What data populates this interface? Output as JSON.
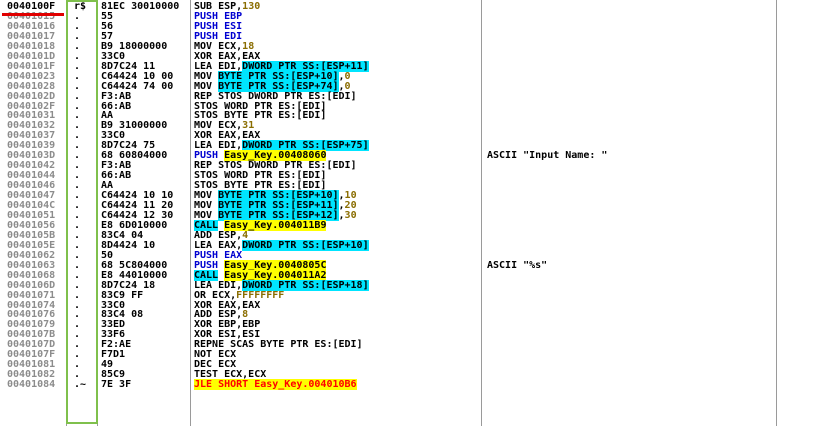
{
  "colors": {
    "cyan_highlight": "#00e5ff",
    "yellow_highlight": "#ffff00",
    "address": "#8c8c8c",
    "mnemonic_blue": "#0000d0",
    "annotation_green": "#7fc04c",
    "annotation_red": "#e00000"
  },
  "rows": [
    {
      "addr": "0040100F",
      "mark": "r$",
      "bytes": "81EC 30010000",
      "dis": [
        [
          "SUB ESP,",
          "black"
        ],
        [
          "130",
          "num"
        ]
      ],
      "cmt": ""
    },
    {
      "addr": "00401015",
      "mark": ".",
      "bytes": "55",
      "dis": [
        [
          "PUSH EBP",
          "blue"
        ]
      ],
      "cmt": ""
    },
    {
      "addr": "00401016",
      "mark": ".",
      "bytes": "56",
      "dis": [
        [
          "PUSH ESI",
          "blue"
        ]
      ],
      "cmt": ""
    },
    {
      "addr": "00401017",
      "mark": ".",
      "bytes": "57",
      "dis": [
        [
          "PUSH EDI",
          "blue"
        ]
      ],
      "cmt": ""
    },
    {
      "addr": "00401018",
      "mark": ".",
      "bytes": "B9 18000000",
      "dis": [
        [
          "MOV ECX,",
          "black"
        ],
        [
          "18",
          "num"
        ]
      ],
      "cmt": ""
    },
    {
      "addr": "0040101D",
      "mark": ".",
      "bytes": "33C0",
      "dis": [
        [
          "XOR EAX,EAX",
          "black"
        ]
      ],
      "cmt": ""
    },
    {
      "addr": "0040101F",
      "mark": ".",
      "bytes": "8D7C24 11",
      "dis": [
        [
          "LEA EDI,",
          "black"
        ],
        [
          "DWORD PTR SS:[ESP+11]",
          "cyan"
        ]
      ],
      "cmt": ""
    },
    {
      "addr": "00401023",
      "mark": ".",
      "bytes": "C64424 10 00",
      "dis": [
        [
          "MOV ",
          "black"
        ],
        [
          "BYTE PTR SS:[ESP+10]",
          "cyan"
        ],
        [
          ",",
          "black"
        ],
        [
          "0",
          "num"
        ]
      ],
      "cmt": ""
    },
    {
      "addr": "00401028",
      "mark": ".",
      "bytes": "C64424 74 00",
      "dis": [
        [
          "MOV ",
          "black"
        ],
        [
          "BYTE PTR SS:[ESP+74]",
          "cyan"
        ],
        [
          ",",
          "black"
        ],
        [
          "0",
          "num"
        ]
      ],
      "cmt": ""
    },
    {
      "addr": "0040102D",
      "mark": ".",
      "bytes": "F3:AB",
      "dis": [
        [
          "REP STOS DWORD PTR ES:[EDI]",
          "black"
        ]
      ],
      "cmt": ""
    },
    {
      "addr": "0040102F",
      "mark": ".",
      "bytes": "66:AB",
      "dis": [
        [
          "STOS WORD PTR ES:[EDI]",
          "black"
        ]
      ],
      "cmt": ""
    },
    {
      "addr": "00401031",
      "mark": ".",
      "bytes": "AA",
      "dis": [
        [
          "STOS BYTE PTR ES:[EDI]",
          "black"
        ]
      ],
      "cmt": ""
    },
    {
      "addr": "00401032",
      "mark": ".",
      "bytes": "B9 31000000",
      "dis": [
        [
          "MOV ECX,",
          "black"
        ],
        [
          "31",
          "num"
        ]
      ],
      "cmt": ""
    },
    {
      "addr": "00401037",
      "mark": ".",
      "bytes": "33C0",
      "dis": [
        [
          "XOR EAX,EAX",
          "black"
        ]
      ],
      "cmt": ""
    },
    {
      "addr": "00401039",
      "mark": ".",
      "bytes": "8D7C24 75",
      "dis": [
        [
          "LEA EDI,",
          "black"
        ],
        [
          "DWORD PTR SS:[ESP+75]",
          "cyan"
        ]
      ],
      "cmt": ""
    },
    {
      "addr": "0040103D",
      "mark": ".",
      "bytes": "68 60804000",
      "dis": [
        [
          "PUSH ",
          "blue"
        ],
        [
          "Easy_Key.00408060",
          "yellow"
        ]
      ],
      "cmt": "ASCII \"Input Name: \""
    },
    {
      "addr": "00401042",
      "mark": ".",
      "bytes": "F3:AB",
      "dis": [
        [
          "REP STOS DWORD PTR ES:[EDI]",
          "black"
        ]
      ],
      "cmt": ""
    },
    {
      "addr": "00401044",
      "mark": ".",
      "bytes": "66:AB",
      "dis": [
        [
          "STOS WORD PTR ES:[EDI]",
          "black"
        ]
      ],
      "cmt": ""
    },
    {
      "addr": "00401046",
      "mark": ".",
      "bytes": "AA",
      "dis": [
        [
          "STOS BYTE PTR ES:[EDI]",
          "black"
        ]
      ],
      "cmt": ""
    },
    {
      "addr": "00401047",
      "mark": ".",
      "bytes": "C64424 10 10",
      "dis": [
        [
          "MOV ",
          "black"
        ],
        [
          "BYTE PTR SS:[ESP+10]",
          "cyan"
        ],
        [
          ",",
          "black"
        ],
        [
          "10",
          "num"
        ]
      ],
      "cmt": ""
    },
    {
      "addr": "0040104C",
      "mark": ".",
      "bytes": "C64424 11 20",
      "dis": [
        [
          "MOV ",
          "black"
        ],
        [
          "BYTE PTR SS:[ESP+11]",
          "cyan"
        ],
        [
          ",",
          "black"
        ],
        [
          "20",
          "num"
        ]
      ],
      "cmt": ""
    },
    {
      "addr": "00401051",
      "mark": ".",
      "bytes": "C64424 12 30",
      "dis": [
        [
          "MOV ",
          "black"
        ],
        [
          "BYTE PTR SS:[ESP+12]",
          "cyan"
        ],
        [
          ",",
          "black"
        ],
        [
          "30",
          "num"
        ]
      ],
      "cmt": ""
    },
    {
      "addr": "00401056",
      "mark": ".",
      "bytes": "E8 6D010000",
      "dis": [
        [
          "CALL",
          "cyan"
        ],
        [
          " ",
          "black"
        ],
        [
          "Easy_Key.004011B9",
          "yellow"
        ]
      ],
      "cmt": ""
    },
    {
      "addr": "0040105B",
      "mark": ".",
      "bytes": "83C4 04",
      "dis": [
        [
          "ADD ESP,",
          "black"
        ],
        [
          "4",
          "num"
        ]
      ],
      "cmt": ""
    },
    {
      "addr": "0040105E",
      "mark": ".",
      "bytes": "8D4424 10",
      "dis": [
        [
          "LEA EAX,",
          "black"
        ],
        [
          "DWORD PTR SS:[ESP+10]",
          "cyan"
        ]
      ],
      "cmt": ""
    },
    {
      "addr": "00401062",
      "mark": ".",
      "bytes": "50",
      "dis": [
        [
          "PUSH EAX",
          "blue"
        ]
      ],
      "cmt": ""
    },
    {
      "addr": "00401063",
      "mark": ".",
      "bytes": "68 5C804000",
      "dis": [
        [
          "PUSH ",
          "blue"
        ],
        [
          "Easy_Key.0040805C",
          "yellow"
        ]
      ],
      "cmt": "ASCII \"%s\""
    },
    {
      "addr": "00401068",
      "mark": ".",
      "bytes": "E8 44010000",
      "dis": [
        [
          "CALL",
          "cyan"
        ],
        [
          " ",
          "black"
        ],
        [
          "Easy_Key.004011A2",
          "yellow"
        ]
      ],
      "cmt": ""
    },
    {
      "addr": "0040106D",
      "mark": ".",
      "bytes": "8D7C24 18",
      "dis": [
        [
          "LEA EDI,",
          "black"
        ],
        [
          "DWORD PTR SS:[ESP+18]",
          "cyan"
        ]
      ],
      "cmt": ""
    },
    {
      "addr": "00401071",
      "mark": ".",
      "bytes": "83C9 FF",
      "dis": [
        [
          "OR ECX,",
          "black"
        ],
        [
          "FFFFFFFF",
          "num"
        ]
      ],
      "cmt": ""
    },
    {
      "addr": "00401074",
      "mark": ".",
      "bytes": "33C0",
      "dis": [
        [
          "XOR EAX,EAX",
          "black"
        ]
      ],
      "cmt": ""
    },
    {
      "addr": "00401076",
      "mark": ".",
      "bytes": "83C4 08",
      "dis": [
        [
          "ADD ESP,",
          "black"
        ],
        [
          "8",
          "num"
        ]
      ],
      "cmt": ""
    },
    {
      "addr": "00401079",
      "mark": ".",
      "bytes": "33ED",
      "dis": [
        [
          "XOR EBP,EBP",
          "black"
        ]
      ],
      "cmt": ""
    },
    {
      "addr": "0040107B",
      "mark": ".",
      "bytes": "33F6",
      "dis": [
        [
          "XOR ESI,ESI",
          "black"
        ]
      ],
      "cmt": ""
    },
    {
      "addr": "0040107D",
      "mark": ".",
      "bytes": "F2:AE",
      "dis": [
        [
          "REPNE SCAS BYTE PTR ES:[EDI]",
          "black"
        ]
      ],
      "cmt": ""
    },
    {
      "addr": "0040107F",
      "mark": ".",
      "bytes": "F7D1",
      "dis": [
        [
          "NOT ECX",
          "black"
        ]
      ],
      "cmt": ""
    },
    {
      "addr": "00401081",
      "mark": ".",
      "bytes": "49",
      "dis": [
        [
          "DEC ECX",
          "black"
        ]
      ],
      "cmt": ""
    },
    {
      "addr": "00401082",
      "mark": ".",
      "bytes": "85C9",
      "dis": [
        [
          "TEST ECX,ECX",
          "black"
        ]
      ],
      "cmt": ""
    },
    {
      "addr": "00401084",
      "mark": ".~",
      "bytes": "7E 3F",
      "dis": [
        [
          "JLE SHORT Easy_Key.004010B6",
          "yellow-red"
        ]
      ],
      "cmt": ""
    }
  ]
}
